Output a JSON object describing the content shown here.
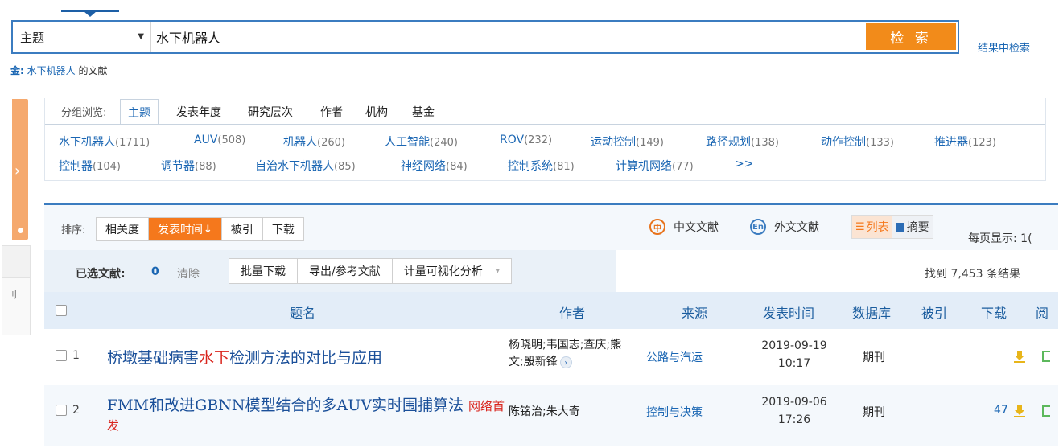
{
  "search": {
    "field": "主题",
    "value": "水下机器人",
    "button": "检 索",
    "in_results": "结果中检索",
    "summary_prefix": "金:",
    "summary_query": "水下机器人",
    "summary_suffix": "的文献"
  },
  "group": {
    "label": "分组浏览:",
    "tabs": [
      "主题",
      "发表年度",
      "研究层次",
      "作者",
      "机构",
      "基金"
    ],
    "items": [
      {
        "name": "水下机器人",
        "count": "(1711)"
      },
      {
        "name": "AUV",
        "count": "(508)"
      },
      {
        "name": "机器人",
        "count": "(260)"
      },
      {
        "name": "人工智能",
        "count": "(240)"
      },
      {
        "name": "ROV",
        "count": "(232)"
      },
      {
        "name": "运动控制",
        "count": "(149)"
      },
      {
        "name": "路径规划",
        "count": "(138)"
      },
      {
        "name": "动作控制",
        "count": "(133)"
      },
      {
        "name": "推进器",
        "count": "(123)"
      },
      {
        "name": "控制器",
        "count": "(104)"
      },
      {
        "name": "调节器",
        "count": "(88)"
      },
      {
        "name": "自治水下机器人",
        "count": "(85)"
      },
      {
        "name": "神经网络",
        "count": "(84)"
      },
      {
        "name": "控制系统",
        "count": "(81)"
      },
      {
        "name": "计算机网络",
        "count": "(77)"
      }
    ],
    "more": ">>"
  },
  "sort": {
    "label": "排序:",
    "options": [
      "相关度",
      "发表时间",
      "被引",
      "下载"
    ],
    "active_arrow": "↓"
  },
  "lang": {
    "cn_icon": "中",
    "cn_label": "中文文献",
    "en_icon": "En",
    "en_label": "外文文献"
  },
  "view": {
    "list_icon": "☰",
    "list": "列表",
    "abstract": "摘要",
    "per_page": "每页显示: 1("
  },
  "actions": {
    "selected_label": "已选文献:",
    "selected_count": "0",
    "clear": "清除",
    "batch_download": "批量下载",
    "export": "导出/参考文献",
    "visual": "计量可视化分析",
    "dropdown": "▾",
    "found": "找到 7,453 条结果"
  },
  "table": {
    "headers": [
      "题名",
      "作者",
      "来源",
      "发表时间",
      "数据库",
      "被引",
      "下载",
      "阅"
    ],
    "rows": [
      {
        "idx": "1",
        "title_pre": "桥墩基础病害",
        "title_hl": "水下",
        "title_post": "检测方法的对比与应用",
        "net": "",
        "net2": "",
        "authors_line1": "杨晓明;韦国志;查庆;熊",
        "authors_line2": "文;殷新锋",
        "author_more": "›",
        "source": "公路与汽运",
        "date": "2019-09-19",
        "time": "10:17",
        "db": "期刊",
        "cited": "",
        "downloads": ""
      },
      {
        "idx": "2",
        "title_pre": "FMM和改进GBNN模型结合的多AUV实时围捕算法",
        "title_hl": "",
        "title_post": "",
        "net": "网络首",
        "net2": "发",
        "authors_line1": "陈铭治;朱大奇",
        "authors_line2": "",
        "author_more": "",
        "source": "控制与决策",
        "date": "2019-09-06",
        "time": "17:26",
        "db": "期刊",
        "cited": "",
        "downloads": "47"
      }
    ]
  },
  "left": {
    "chevron": "›",
    "stub_text": "刂"
  },
  "colors": {
    "accent": "#3b7cc0",
    "orange": "#f5781c",
    "link": "#1a66b3",
    "highlight": "#d9251d"
  }
}
